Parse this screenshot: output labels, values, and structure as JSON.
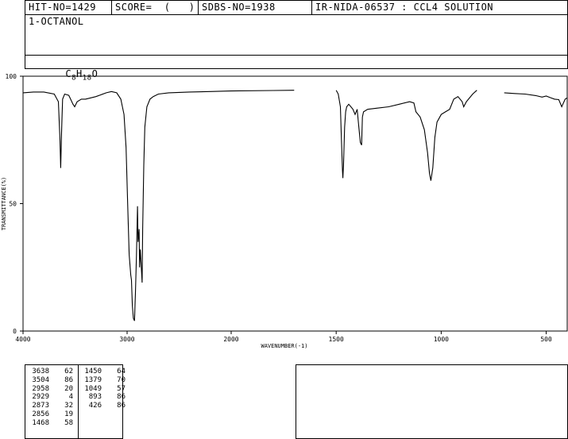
{
  "header": {
    "hit_no": "HIT-NO=1429",
    "score": "SCORE=  (   )",
    "sdbs_no": "SDBS-NO=1938",
    "ir_id": "IR-NIDA-06537 : CCL4 SOLUTION"
  },
  "compound_name": "1-OCTANOL",
  "formula": {
    "c": "C",
    "c_n": "8",
    "h": "H",
    "h_n": "18",
    "o": "O"
  },
  "chart_data": {
    "type": "line",
    "xlabel": "WAVENUMBER(-1)",
    "ylabel": "TRANSMITTANCE(%)",
    "xlim": [
      4000,
      400
    ],
    "ylim": [
      0,
      100
    ],
    "xticks": [
      "4000",
      "3000",
      "2000",
      "1500",
      "1000",
      "500"
    ],
    "yticks": [
      "0",
      "50",
      "100"
    ],
    "series": [
      {
        "points": [
          [
            4000,
            93.5
          ],
          [
            3900,
            93.8
          ],
          [
            3800,
            93.8
          ],
          [
            3700,
            93
          ],
          [
            3660,
            90
          ],
          [
            3645,
            75
          ],
          [
            3638,
            64
          ],
          [
            3630,
            78
          ],
          [
            3620,
            91
          ],
          [
            3600,
            93
          ],
          [
            3560,
            92.5
          ],
          [
            3520,
            89
          ],
          [
            3504,
            88
          ],
          [
            3480,
            90
          ],
          [
            3440,
            91
          ],
          [
            3400,
            91
          ],
          [
            3300,
            92
          ],
          [
            3200,
            93.5
          ],
          [
            3150,
            94
          ],
          [
            3100,
            93.5
          ],
          [
            3060,
            91
          ],
          [
            3030,
            85
          ],
          [
            3010,
            72
          ],
          [
            2995,
            50
          ],
          [
            2980,
            30
          ],
          [
            2965,
            22
          ],
          [
            2958,
            20
          ],
          [
            2950,
            10
          ],
          [
            2940,
            5
          ],
          [
            2929,
            4
          ],
          [
            2920,
            15
          ],
          [
            2910,
            30
          ],
          [
            2900,
            49
          ],
          [
            2895,
            35
          ],
          [
            2885,
            40
          ],
          [
            2880,
            25
          ],
          [
            2873,
            32
          ],
          [
            2865,
            26
          ],
          [
            2856,
            19
          ],
          [
            2850,
            40
          ],
          [
            2840,
            65
          ],
          [
            2830,
            80
          ],
          [
            2810,
            88
          ],
          [
            2780,
            91
          ],
          [
            2750,
            92
          ],
          [
            2700,
            93
          ],
          [
            2600,
            93.5
          ],
          [
            2400,
            93.8
          ],
          [
            2200,
            94
          ],
          [
            2000,
            94.2
          ],
          [
            1800,
            94.4
          ],
          [
            1700,
            94.5
          ]
        ]
      },
      {
        "points": [
          [
            1500,
            94.5
          ],
          [
            1490,
            93
          ],
          [
            1480,
            88
          ],
          [
            1475,
            75
          ],
          [
            1470,
            63
          ],
          [
            1468,
            60
          ],
          [
            1465,
            65
          ],
          [
            1460,
            80
          ],
          [
            1455,
            86
          ],
          [
            1450,
            88
          ],
          [
            1440,
            89
          ],
          [
            1430,
            88
          ],
          [
            1420,
            87
          ],
          [
            1410,
            85
          ],
          [
            1400,
            87
          ],
          [
            1392,
            80
          ],
          [
            1385,
            74
          ],
          [
            1379,
            73
          ],
          [
            1375,
            84
          ],
          [
            1370,
            86
          ],
          [
            1350,
            87
          ],
          [
            1300,
            87.5
          ],
          [
            1250,
            88
          ],
          [
            1200,
            89
          ],
          [
            1150,
            90
          ],
          [
            1130,
            89.5
          ],
          [
            1120,
            86
          ],
          [
            1100,
            84
          ],
          [
            1080,
            79
          ],
          [
            1065,
            70
          ],
          [
            1056,
            62
          ],
          [
            1049,
            59
          ],
          [
            1040,
            64
          ],
          [
            1030,
            76
          ],
          [
            1020,
            82
          ],
          [
            1000,
            85
          ],
          [
            980,
            86
          ],
          [
            960,
            87
          ],
          [
            940,
            91
          ],
          [
            920,
            92
          ],
          [
            900,
            90
          ],
          [
            893,
            88
          ],
          [
            880,
            90
          ],
          [
            850,
            93
          ],
          [
            830,
            94.5
          ]
        ]
      },
      {
        "points": [
          [
            700,
            93.5
          ],
          [
            650,
            93.2
          ],
          [
            600,
            93
          ],
          [
            550,
            92.4
          ],
          [
            520,
            91.8
          ],
          [
            500,
            92.2
          ],
          [
            480,
            91.6
          ],
          [
            460,
            91
          ],
          [
            440,
            90.8
          ],
          [
            426,
            88
          ],
          [
            410,
            91
          ],
          [
            400,
            91.5
          ]
        ]
      }
    ],
    "peaks": [
      {
        "wavenumber": "3638",
        "transmittance": "62"
      },
      {
        "wavenumber": "3504",
        "transmittance": "86"
      },
      {
        "wavenumber": "2958",
        "transmittance": "20"
      },
      {
        "wavenumber": "2929",
        "transmittance": "4"
      },
      {
        "wavenumber": "2873",
        "transmittance": "32"
      },
      {
        "wavenumber": "2856",
        "transmittance": "19"
      },
      {
        "wavenumber": "1468",
        "transmittance": "58"
      },
      {
        "wavenumber": "1450",
        "transmittance": "64"
      },
      {
        "wavenumber": "1379",
        "transmittance": "70"
      },
      {
        "wavenumber": "1049",
        "transmittance": "57"
      },
      {
        "wavenumber": "893",
        "transmittance": "86"
      },
      {
        "wavenumber": "426",
        "transmittance": "86"
      }
    ]
  }
}
